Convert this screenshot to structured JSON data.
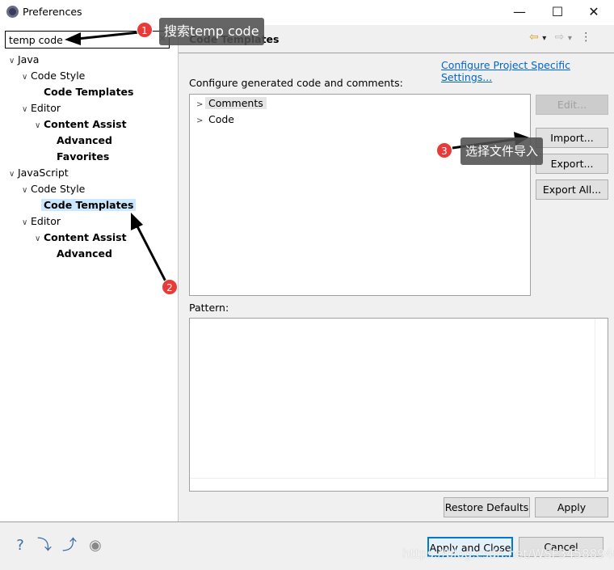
{
  "window": {
    "title": "Preferences",
    "minimize": "—",
    "maximize": "☐",
    "close": "✕"
  },
  "search": {
    "value": "temp code",
    "clear_icon": "×"
  },
  "tree": [
    {
      "label": "Java",
      "level": 0,
      "chev": true,
      "bold": false
    },
    {
      "label": "Code Style",
      "level": 1,
      "chev": true,
      "bold": false
    },
    {
      "label": "Code Templates",
      "level": 2,
      "chev": false,
      "bold": true
    },
    {
      "label": "Editor",
      "level": 1,
      "chev": true,
      "bold": false
    },
    {
      "label": "Content Assist",
      "level": 2,
      "chev": true,
      "bold": true
    },
    {
      "label": "Advanced",
      "level": 3,
      "chev": false,
      "bold": true
    },
    {
      "label": "Favorites",
      "level": 3,
      "chev": false,
      "bold": true
    },
    {
      "label": "JavaScript",
      "level": 0,
      "chev": true,
      "bold": false
    },
    {
      "label": "Code Style",
      "level": 1,
      "chev": true,
      "bold": false
    },
    {
      "label": "Code Templates",
      "level": 2,
      "chev": false,
      "bold": true,
      "selected": true
    },
    {
      "label": "Editor",
      "level": 1,
      "chev": true,
      "bold": false
    },
    {
      "label": "Content Assist",
      "level": 2,
      "chev": true,
      "bold": true
    },
    {
      "label": "Advanced",
      "level": 3,
      "chev": false,
      "bold": true
    }
  ],
  "page": {
    "title": "Code Templates",
    "nav": {
      "back": "⇦",
      "back_menu": "▾",
      "forward": "⇨",
      "forward_menu": "▾",
      "more": "⋮"
    },
    "link": "Configure Project Specific Settings...",
    "configure_label": "Configure generated code and comments:",
    "items": [
      {
        "label": "Comments"
      },
      {
        "label": "Code"
      }
    ],
    "buttons": {
      "edit": "Edit...",
      "import": "Import...",
      "export": "Export...",
      "export_all": "Export All..."
    },
    "pattern_label": "Pattern:",
    "restore_defaults": "Restore Defaults",
    "apply": "Apply"
  },
  "footer": {
    "apply_close": "Apply and Close",
    "cancel": "Cancel",
    "icons": [
      "help-icon",
      "import-icon",
      "export-icon",
      "record-icon"
    ]
  },
  "watermark": "https://blog.csdn.net/WSF34588940",
  "annotations": [
    {
      "number": "1",
      "text": "搜索temp code"
    },
    {
      "number": "2"
    },
    {
      "number": "3",
      "text": "选择文件导入"
    }
  ],
  "colors": {
    "accent": "#0078d7",
    "selection": "#cce8ff",
    "link": "#0066cc",
    "badge": "#e93a3a"
  }
}
